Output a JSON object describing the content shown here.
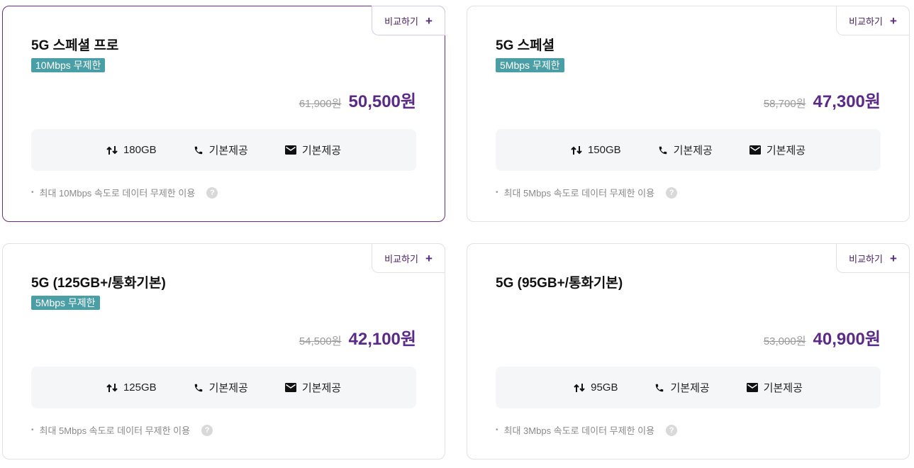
{
  "compare_label": "비교하기",
  "plans": [
    {
      "title": "5G 스페셜 프로",
      "badge": "10Mbps 무제한",
      "old_price": "61,900원",
      "new_price": "50,500원",
      "data": "180GB",
      "voice": "기본제공",
      "sms": "기본제공",
      "note": "최대 10Mbps 속도로 데이터 무제한 이용",
      "selected": true
    },
    {
      "title": "5G 스페셜",
      "badge": "5Mbps 무제한",
      "old_price": "58,700원",
      "new_price": "47,300원",
      "data": "150GB",
      "voice": "기본제공",
      "sms": "기본제공",
      "note": "최대 5Mbps 속도로 데이터 무제한 이용",
      "selected": false
    },
    {
      "title": "5G (125GB+/통화기본)",
      "badge": "5Mbps 무제한",
      "old_price": "54,500원",
      "new_price": "42,100원",
      "data": "125GB",
      "voice": "기본제공",
      "sms": "기본제공",
      "note": "최대 5Mbps 속도로 데이터 무제한 이용",
      "selected": false
    },
    {
      "title": "5G (95GB+/통화기본)",
      "badge": "",
      "old_price": "53,000원",
      "new_price": "40,900원",
      "data": "95GB",
      "voice": "기본제공",
      "sms": "기본제공",
      "note": "최대 3Mbps 속도로 데이터 무제한 이용",
      "selected": false
    }
  ],
  "icons": {
    "data": "data-arrows-icon",
    "voice": "phone-icon",
    "sms": "envelope-icon",
    "help": "help-icon",
    "compare": "plus-icon"
  },
  "colors": {
    "accent": "#5b2a86",
    "badge": "#4a9fa6",
    "selected_border": "#6a2c80"
  }
}
